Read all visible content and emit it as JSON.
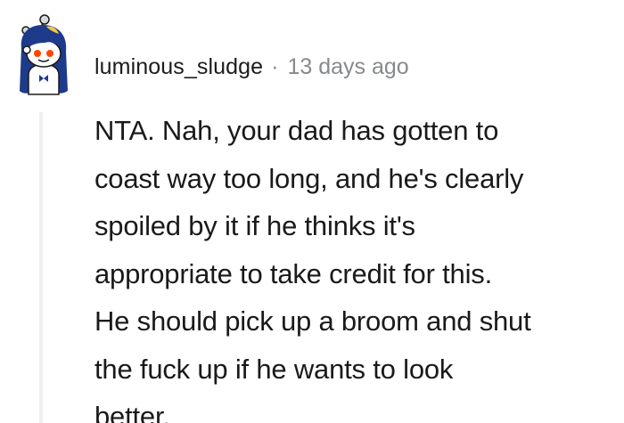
{
  "comment": {
    "username": "luminous_sludge",
    "separator": "·",
    "timestamp": "13 days ago",
    "avatar_icon": "snoo-avatar-icon",
    "body_lines": [
      "NTA. Nah, your dad has gotten to",
      "coast way too long, and he's clearly",
      "spoiled by it if he thinks it's",
      "appropriate to take credit for this.",
      "He should pick up a broom and shut",
      "the fuck up if he wants to look",
      "better."
    ]
  },
  "colors": {
    "username": "#1c1c1c",
    "meta": "#878a8c",
    "text": "#1a1a1b",
    "thread_line": "#edeff1",
    "avatar_hair": "#1e3a8a",
    "avatar_eyes": "#ff4500"
  }
}
